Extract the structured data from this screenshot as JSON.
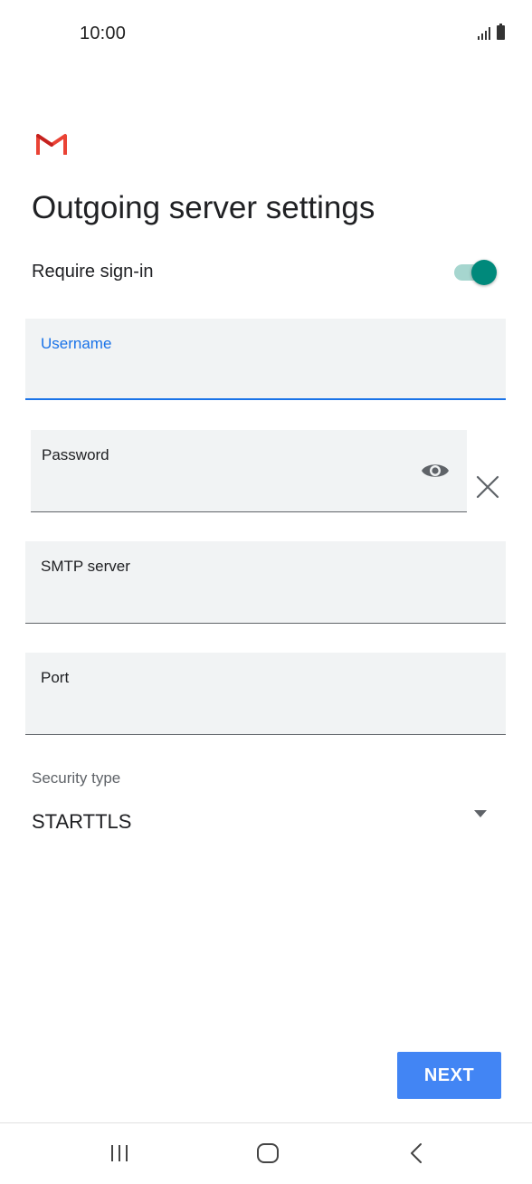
{
  "status_bar": {
    "time": "10:00",
    "icons": [
      "signal-icon",
      "battery-icon"
    ]
  },
  "app": {
    "logo": "gmail-logo",
    "brand_colors": [
      "#ea4335",
      "#c5221f"
    ]
  },
  "page": {
    "title": "Outgoing server settings"
  },
  "require_signin": {
    "label": "Require sign-in",
    "enabled": true,
    "accent_color": "#00897b"
  },
  "fields": {
    "username": {
      "label": "Username",
      "value": "",
      "focused": true
    },
    "password": {
      "label": "Password",
      "value": ""
    },
    "smtp_server": {
      "label": "SMTP server",
      "value": ""
    },
    "port": {
      "label": "Port",
      "value": ""
    }
  },
  "security": {
    "label": "Security type",
    "selected": "STARTTLS"
  },
  "actions": {
    "next_label": "NEXT",
    "next_color": "#4285f4"
  },
  "nav_bar": {
    "icons": [
      "recent-apps-icon",
      "home-icon",
      "back-icon"
    ]
  }
}
